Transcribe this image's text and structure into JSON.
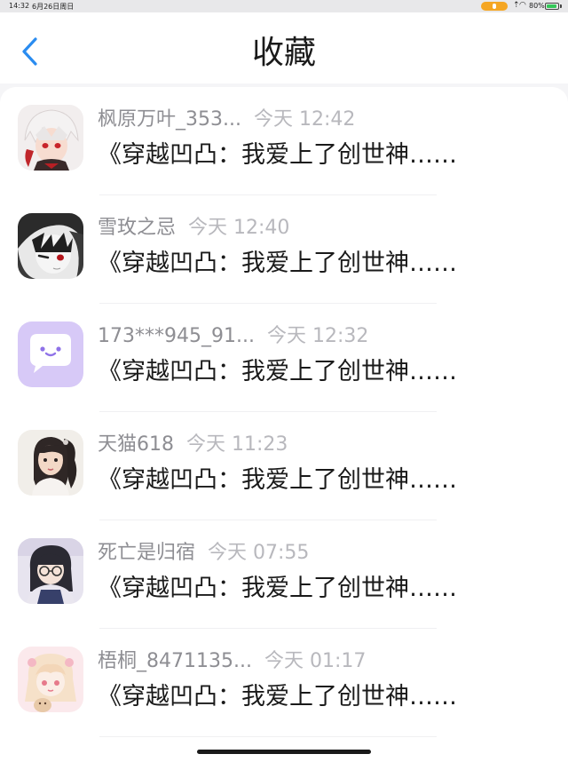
{
  "status_bar": {
    "time": "14:32",
    "date": "6月26日周日",
    "battery": "80%"
  },
  "header": {
    "title": "收藏",
    "back_icon": "chevron-left-icon"
  },
  "items": [
    {
      "name": "枫原万叶_353...",
      "time": "今天 12:42",
      "content": "《穿越凹凸：我爱上了创世神……",
      "avatar": "anime-avatar-white-hair"
    },
    {
      "name": "雪玫之忌",
      "time": "今天 12:40",
      "content": "《穿越凹凸：我爱上了创世神……",
      "avatar": "anime-avatar-monochrome"
    },
    {
      "name": "173***945_91...",
      "time": "今天 12:32",
      "content": "《穿越凹凸：我爱上了创世神……",
      "avatar": "chat-bubble-avatar"
    },
    {
      "name": "天猫618",
      "time": "今天 11:23",
      "content": "《穿越凹凸：我爱上了创世神……",
      "avatar": "ponytail-girl-avatar"
    },
    {
      "name": "死亡是归宿",
      "time": "今天 07:55",
      "content": "《穿越凹凸：我爱上了创世神……",
      "avatar": "glasses-girl-avatar"
    },
    {
      "name": "梧桐_8471135...",
      "time": "今天 01:17",
      "content": "《穿越凹凸：我爱上了创世神……",
      "avatar": "pink-anime-avatar"
    }
  ],
  "colors": {
    "accent": "#2a8cf0",
    "chat_bubble_bg": "#d7c9f7"
  }
}
